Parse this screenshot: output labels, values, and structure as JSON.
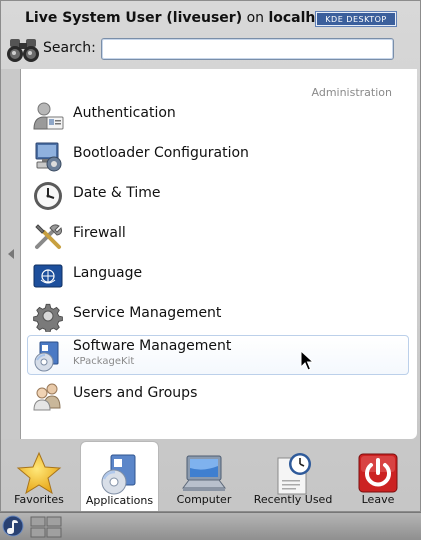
{
  "header": {
    "user_name": "Live System User (liveuser)",
    "on_text": "on",
    "host": "localhost",
    "badge": "KDE DESKTOP"
  },
  "search": {
    "label": "Search:",
    "value": "",
    "placeholder": ""
  },
  "section": {
    "title": "Administration"
  },
  "apps": [
    {
      "name": "Authentication",
      "subtitle": "",
      "icon": "authentication-icon"
    },
    {
      "name": "Bootloader Configuration",
      "subtitle": "",
      "icon": "bootloader-icon"
    },
    {
      "name": "Date & Time",
      "subtitle": "",
      "icon": "clock-icon"
    },
    {
      "name": "Firewall",
      "subtitle": "",
      "icon": "firewall-tools-icon"
    },
    {
      "name": "Language",
      "subtitle": "",
      "icon": "language-flag-icon"
    },
    {
      "name": "Service Management",
      "subtitle": "",
      "icon": "gear-icon"
    },
    {
      "name": "Software Management",
      "subtitle": "KPackageKit",
      "icon": "package-cd-icon"
    },
    {
      "name": "Users and Groups",
      "subtitle": "",
      "icon": "users-icon"
    }
  ],
  "tabs": [
    {
      "label": "Favorites",
      "icon": "star-icon"
    },
    {
      "label": "Applications",
      "icon": "applications-icon"
    },
    {
      "label": "Computer",
      "icon": "computer-icon"
    },
    {
      "label": "Recently Used",
      "icon": "clock-document-icon"
    },
    {
      "label": "Leave",
      "icon": "power-icon"
    }
  ],
  "colors": {
    "accent": "#3b5f9c",
    "hover_border": "#bcd0ea",
    "leave_red": "#c82020"
  }
}
